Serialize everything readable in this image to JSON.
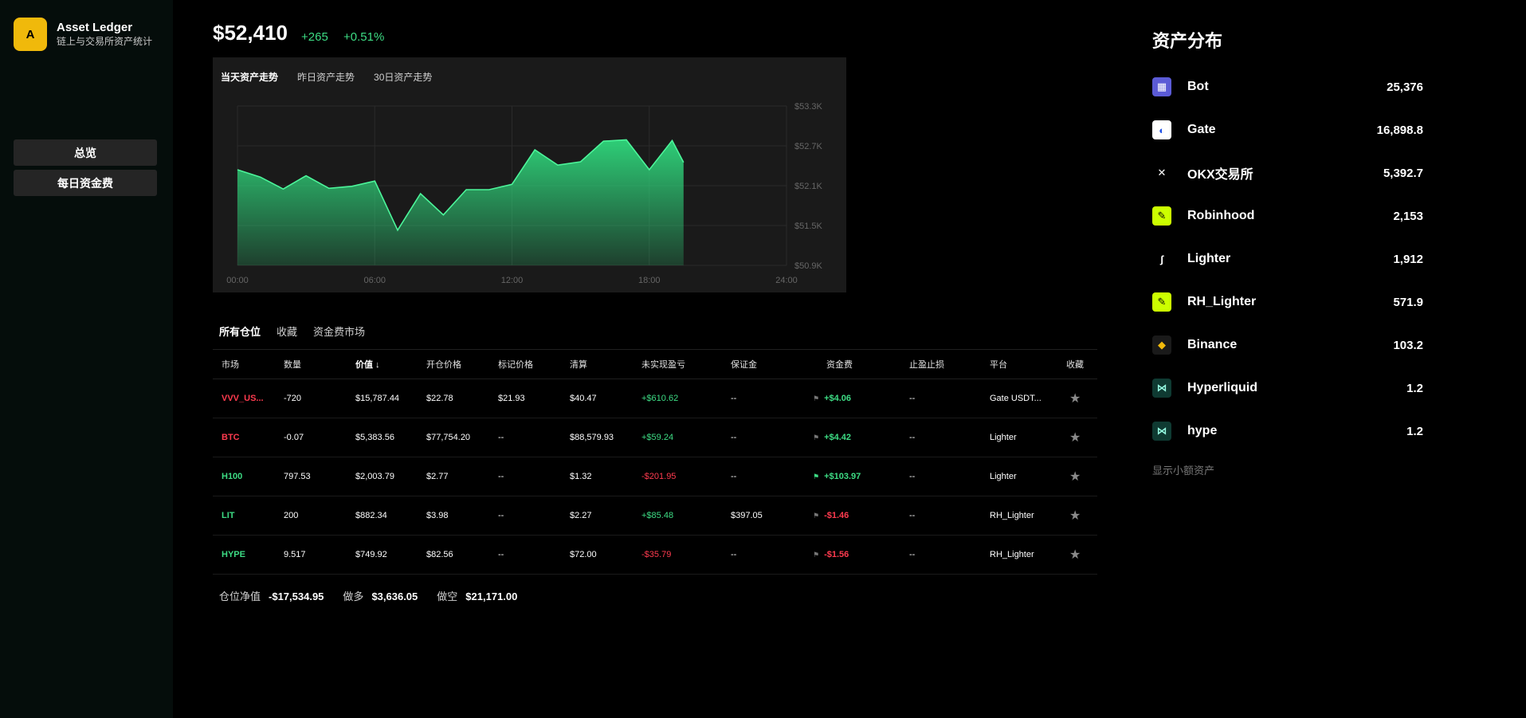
{
  "app": {
    "logo_letter": "A",
    "name": "Asset Ledger",
    "subtitle": "链上与交易所资产统计"
  },
  "nav": [
    {
      "label": "总览"
    },
    {
      "label": "每日资金费"
    }
  ],
  "header": {
    "total": "$52,410",
    "change_abs": "+265",
    "change_pct": "+0.51%"
  },
  "chart_tabs": [
    {
      "label": "当天资产走势",
      "active": true
    },
    {
      "label": "昨日资产走势"
    },
    {
      "label": "30日资产走势"
    }
  ],
  "chart_data": {
    "type": "area",
    "x_ticks": [
      "00:00",
      "06:00",
      "12:00",
      "18:00",
      "24:00"
    ],
    "y_ticks": [
      "$53.3K",
      "$52.7K",
      "$52.1K",
      "$51.5K",
      "$50.9K"
    ],
    "ylim": [
      50900,
      53300
    ],
    "xlim_hours": [
      0,
      24
    ],
    "color": "#2fd77c",
    "x": [
      "00:00",
      "01:00",
      "02:00",
      "03:00",
      "04:00",
      "05:00",
      "06:00",
      "07:00",
      "08:00",
      "09:00",
      "10:00",
      "11:00",
      "12:00",
      "13:00",
      "14:00",
      "15:00",
      "16:00",
      "17:00",
      "18:00",
      "19:00",
      "19:30"
    ],
    "x_hours": [
      0,
      1,
      2,
      3,
      4,
      5,
      6,
      7,
      8,
      9,
      10,
      11,
      12,
      13,
      14,
      15,
      16,
      17,
      18,
      19,
      19.5
    ],
    "values": [
      52340,
      52230,
      52050,
      52250,
      52060,
      52090,
      52170,
      51430,
      51980,
      51660,
      52040,
      52040,
      52120,
      52640,
      52410,
      52460,
      52770,
      52790,
      52340,
      52780,
      52450
    ]
  },
  "positions": {
    "tabs": [
      {
        "label": "所有仓位",
        "active": true
      },
      {
        "label": "收藏"
      },
      {
        "label": "资金费市场"
      }
    ],
    "headers": [
      "市场",
      "数量",
      "价值 ↓",
      "开仓价格",
      "标记价格",
      "清算",
      "未实现盈亏",
      "保证金",
      "资金费",
      "止盈止损",
      "平台",
      "收藏"
    ],
    "rows": [
      {
        "market": "VVV_US...",
        "market_color": "red",
        "qty": "-720",
        "value": "$15,787.44",
        "entry": "$22.78",
        "mark": "$21.93",
        "liq": "$40.47",
        "pnl": "+$610.62",
        "pnl_color": "green",
        "margin": "--",
        "flag_color": "gray",
        "fee": "+$4.06",
        "fee_color": "green",
        "tpsl": "--",
        "platform": "Gate USDT...",
        "star": "★"
      },
      {
        "market": "BTC",
        "market_color": "red",
        "qty": "-0.07",
        "value": "$5,383.56",
        "entry": "$77,754.20",
        "mark": "--",
        "liq": "$88,579.93",
        "pnl": "+$59.24",
        "pnl_color": "green",
        "margin": "--",
        "flag_color": "gray",
        "fee": "+$4.42",
        "fee_color": "green",
        "tpsl": "--",
        "platform": "Lighter",
        "star": "★"
      },
      {
        "market": "H100",
        "market_color": "green",
        "qty": "797.53",
        "value": "$2,003.79",
        "entry": "$2.77",
        "mark": "--",
        "liq": "$1.32",
        "pnl": "-$201.95",
        "pnl_color": "red",
        "margin": "--",
        "flag_color": "green",
        "fee": "+$103.97",
        "fee_color": "green",
        "tpsl": "--",
        "platform": "Lighter",
        "star": "★"
      },
      {
        "market": "LIT",
        "market_color": "green",
        "qty": "200",
        "value": "$882.34",
        "entry": "$3.98",
        "mark": "--",
        "liq": "$2.27",
        "pnl": "+$85.48",
        "pnl_color": "green",
        "margin": "$397.05",
        "flag_color": "gray",
        "fee": "-$1.46",
        "fee_color": "red",
        "tpsl": "--",
        "platform": "RH_Lighter",
        "star": "★"
      },
      {
        "market": "HYPE",
        "market_color": "green",
        "qty": "9.517",
        "value": "$749.92",
        "entry": "$82.56",
        "mark": "--",
        "liq": "$72.00",
        "pnl": "-$35.79",
        "pnl_color": "red",
        "margin": "--",
        "flag_color": "gray",
        "fee": "-$1.56",
        "fee_color": "red",
        "tpsl": "--",
        "platform": "RH_Lighter",
        "star": "★"
      }
    ],
    "summary": {
      "net_label": "仓位净值",
      "net": "-$17,534.95",
      "long_label": "做多",
      "long": "$3,636.05",
      "short_label": "做空",
      "short": "$21,171.00"
    }
  },
  "allocation": {
    "title": "资产分布",
    "items": [
      {
        "name": "Bot",
        "value": "25,376",
        "icon": "bot-icon",
        "bg": "#5b5bd6",
        "fg": "#fff",
        "glyph": "▦"
      },
      {
        "name": "Gate",
        "value": "16,898.8",
        "icon": "gate-icon",
        "bg": "#ffffff",
        "fg": "#2354e6",
        "glyph": "◐"
      },
      {
        "name": "OKX交易所",
        "value": "5,392.7",
        "icon": "okx-icon",
        "bg": "#000000",
        "fg": "#fff",
        "glyph": "✕"
      },
      {
        "name": "Robinhood",
        "value": "2,153",
        "icon": "robinhood-icon",
        "bg": "#ccff00",
        "fg": "#000",
        "glyph": "✎"
      },
      {
        "name": "Lighter",
        "value": "1,912",
        "icon": "lighter-icon",
        "bg": "#000000",
        "fg": "#fff",
        "glyph": "ʃ"
      },
      {
        "name": "RH_Lighter",
        "value": "571.9",
        "icon": "robinhood-icon",
        "bg": "#ccff00",
        "fg": "#000",
        "glyph": "✎"
      },
      {
        "name": "Binance",
        "value": "103.2",
        "icon": "binance-icon",
        "bg": "#1a1a1a",
        "fg": "#f0b90b",
        "glyph": "◆"
      },
      {
        "name": "Hyperliquid",
        "value": "1.2",
        "icon": "hyperliquid-icon",
        "bg": "#0f3a32",
        "fg": "#97fce4",
        "glyph": "⋈"
      },
      {
        "name": "hype",
        "value": "1.2",
        "icon": "hyperliquid-icon",
        "bg": "#0f3a32",
        "fg": "#97fce4",
        "glyph": "⋈"
      }
    ],
    "show_small": "显示小额资产"
  }
}
